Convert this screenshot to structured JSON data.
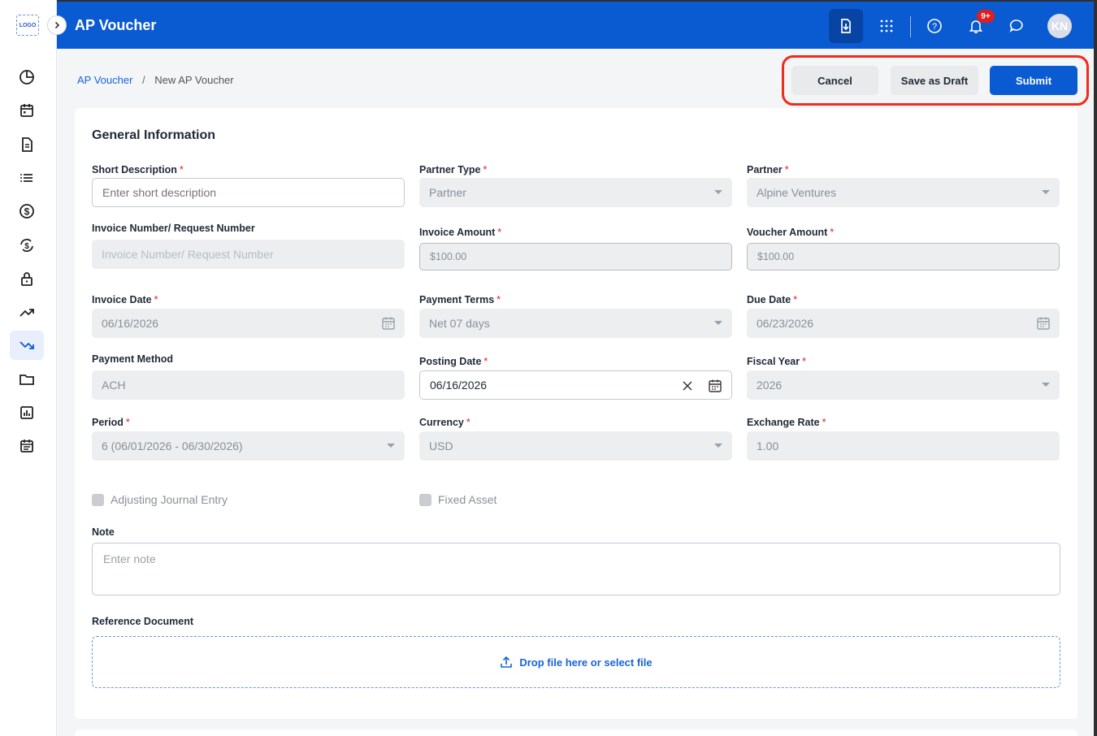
{
  "app": {
    "logo_text": "LOGO",
    "title": "AP Voucher",
    "notification_count": "9+",
    "avatar_initials": "KN"
  },
  "colors": {
    "primary": "#0a5bd1",
    "highlight": "#f02c1c",
    "required": "#e11d1d"
  },
  "sidebar": {
    "items": [
      {
        "name": "dashboard-icon"
      },
      {
        "name": "calendar-icon"
      },
      {
        "name": "document-icon"
      },
      {
        "name": "list-icon"
      },
      {
        "name": "dollar-icon"
      },
      {
        "name": "currency-exchange-icon"
      },
      {
        "name": "lock-icon"
      },
      {
        "name": "trending-up-icon"
      },
      {
        "name": "trending-down-icon",
        "active": true
      },
      {
        "name": "folder-icon"
      },
      {
        "name": "report-icon"
      },
      {
        "name": "schedule-icon"
      }
    ]
  },
  "breadcrumb": {
    "parent": "AP Voucher",
    "separator": "/",
    "current": "New AP Voucher"
  },
  "actions": {
    "cancel": "Cancel",
    "save_draft": "Save as Draft",
    "submit": "Submit"
  },
  "form": {
    "section_title": "General Information",
    "short_description": {
      "label": "Short Description",
      "placeholder": "Enter short description"
    },
    "partner_type": {
      "label": "Partner Type",
      "value": "Partner"
    },
    "partner": {
      "label": "Partner",
      "value": "Alpine Ventures"
    },
    "invoice_number": {
      "label": "Invoice Number/ Request Number",
      "placeholder": "Invoice Number/ Request Number"
    },
    "invoice_amount": {
      "label": "Invoice Amount",
      "value": "$100.00"
    },
    "voucher_amount": {
      "label": "Voucher Amount",
      "value": "$100.00"
    },
    "invoice_date": {
      "label": "Invoice Date",
      "value": "06/16/2026"
    },
    "payment_terms": {
      "label": "Payment Terms",
      "value": "Net 07 days"
    },
    "due_date": {
      "label": "Due Date",
      "value": "06/23/2026"
    },
    "payment_method": {
      "label": "Payment Method",
      "value": "ACH"
    },
    "posting_date": {
      "label": "Posting Date",
      "value": "06/16/2026"
    },
    "fiscal_year": {
      "label": "Fiscal Year",
      "value": "2026"
    },
    "period": {
      "label": "Period",
      "value": "6 (06/01/2026 - 06/30/2026)"
    },
    "currency": {
      "label": "Currency",
      "value": "USD"
    },
    "exchange_rate": {
      "label": "Exchange Rate",
      "value": "1.00"
    },
    "adjusting_journal_entry": {
      "label": "Adjusting Journal Entry",
      "checked": false
    },
    "fixed_asset": {
      "label": "Fixed Asset",
      "checked": false
    },
    "note": {
      "label": "Note",
      "placeholder": "Enter note"
    },
    "reference_document": {
      "label": "Reference Document",
      "dropzone_text": "Drop file here or select file"
    }
  }
}
